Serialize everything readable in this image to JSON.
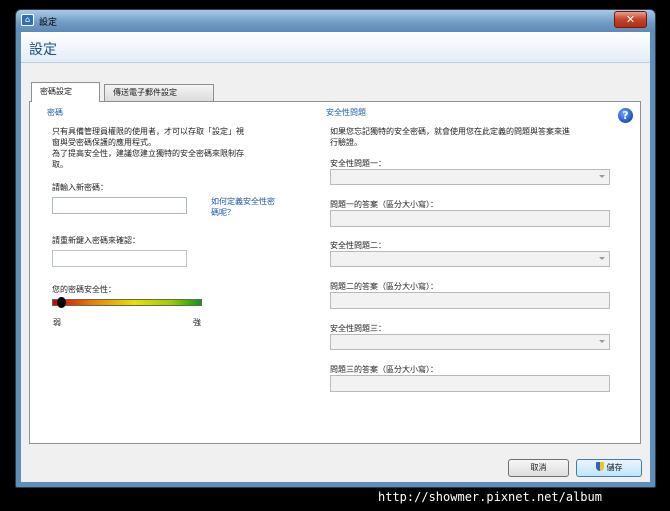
{
  "window": {
    "title": "設定",
    "close_label": "✕"
  },
  "page_title": "設定",
  "tabs": [
    {
      "label": "密碼設定",
      "active": true
    },
    {
      "label": "傳送電子郵件設定",
      "active": false
    }
  ],
  "password": {
    "section_title": "密碼",
    "description_lines": [
      "只有具備管理員權限的使用者，才可以存取「設定」視",
      "窗與受密碼保護的應用程式。",
      "為了提高安全性，建議您建立獨特的安全密碼來限制存",
      "取。"
    ],
    "new_password_label": "請輸入新密碼：",
    "new_password_value": "",
    "help_link_lines": [
      "如何定義安全性密",
      "碼呢？"
    ],
    "confirm_label": "請重新鍵入密碼來確認：",
    "confirm_value": "",
    "strength_label": "您的密碼安全性：",
    "strength_level": 0.05,
    "weak_label": "弱",
    "strong_label": "強"
  },
  "security": {
    "section_title": "安全性問題",
    "description_lines": [
      "如果您忘記獨特的安全密碼，就會使用您在此定義的問題與答案來進",
      "行驗證。"
    ],
    "items": [
      {
        "question_label": "安全性問題一：",
        "question_value": "",
        "answer_label": "問題一的答案（區分大小寫）：",
        "answer_value": ""
      },
      {
        "question_label": "安全性問題二：",
        "question_value": "",
        "answer_label": "問題二的答案（區分大小寫）：",
        "answer_value": ""
      },
      {
        "question_label": "安全性問題三：",
        "question_value": "",
        "answer_label": "問題三的答案（區分大小寫）：",
        "answer_value": ""
      }
    ]
  },
  "buttons": {
    "cancel": "取消",
    "save": "儲存"
  },
  "icons": {
    "help": "?",
    "app": "⌂"
  },
  "watermark": "http://showmer.pixnet.net/album",
  "colors": {
    "accent": "#1e5ea8",
    "title_bar": "#6f9ac3"
  }
}
